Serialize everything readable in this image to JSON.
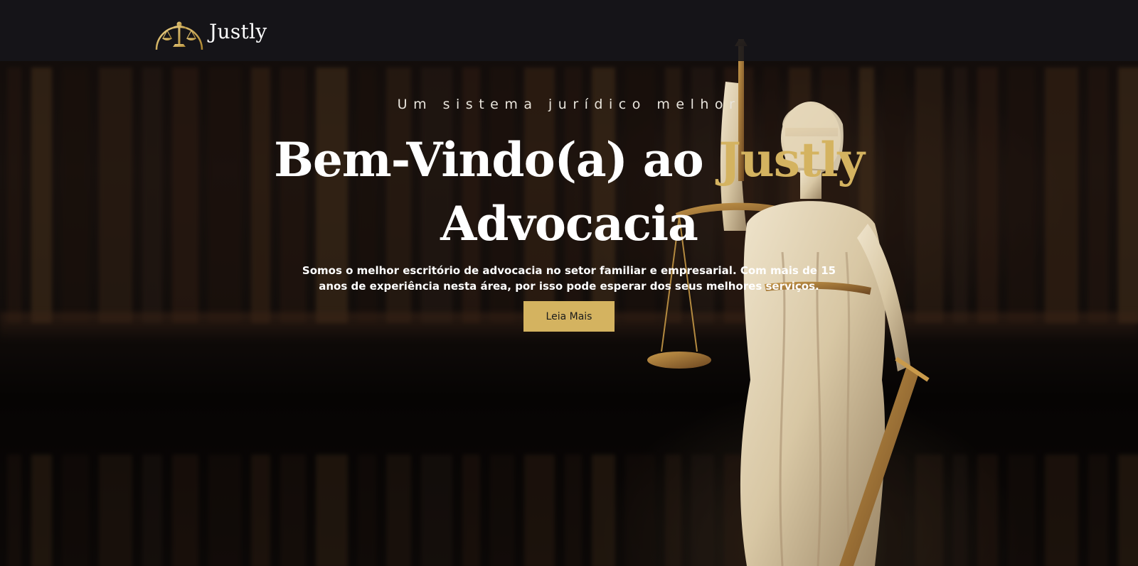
{
  "header": {
    "brand_name": "Justly",
    "logo_icon": "scales-of-justice-icon"
  },
  "hero": {
    "tagline": "Um sistema jurídico melhor",
    "headline_part1": "Bem-Vindo(a) ao",
    "headline_accent": "Justly",
    "headline_part2": "Advocacia",
    "description": "Somos o melhor escritório de advocacia no setor familiar e empresarial. Com mais de 15 anos de experiência nesta área, por isso pode esperar dos seus melhores serviços.",
    "cta_label": "Leia Mais"
  },
  "colors": {
    "accent": "#d4b360",
    "header_bg": "#16161a",
    "text": "#ffffff"
  },
  "background_image": "lady-justice-statue-bookshelf"
}
